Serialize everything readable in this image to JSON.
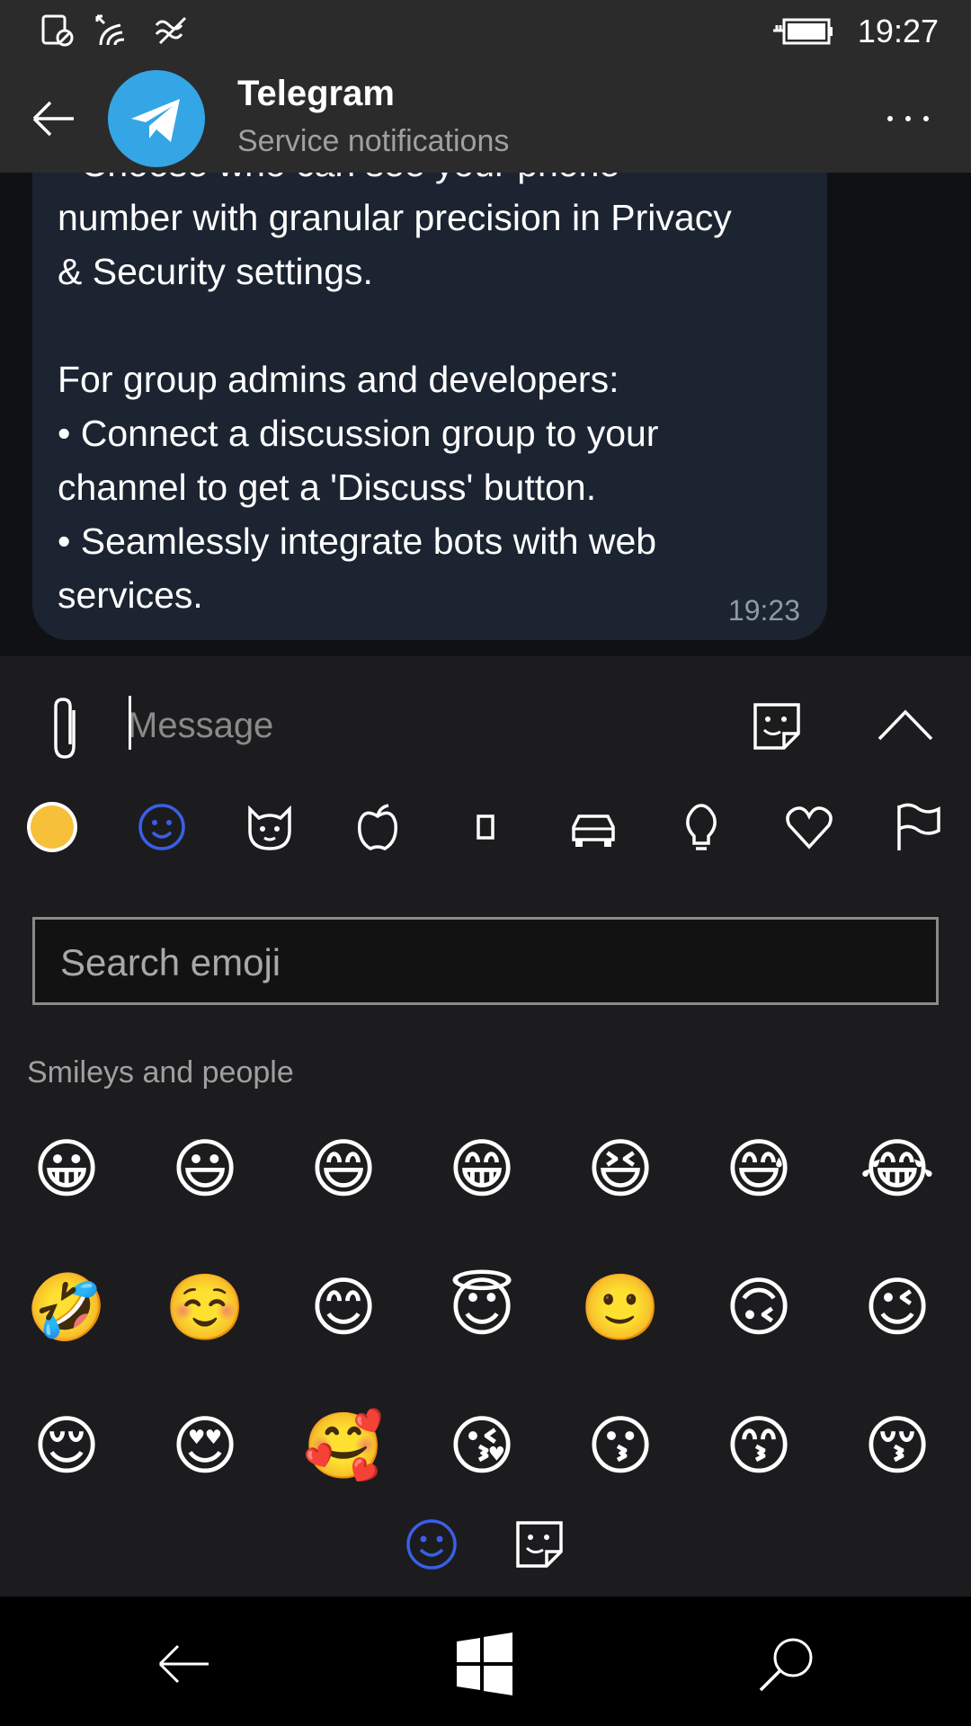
{
  "status_bar": {
    "time": "19:27",
    "icons": [
      "battery-saver-icon",
      "wifi-icon",
      "cellular-icon",
      "battery-charging-icon"
    ]
  },
  "header": {
    "title": "Telegram",
    "subtitle": "Service notifications",
    "more_label": "...",
    "accent": "#34a5e5"
  },
  "message": {
    "text": "• Choose who can see your phone\nnumber with granular precision in Privacy\n& Security settings.\n\nFor group admins and developers:\n• Connect a discussion group to your\nchannel to get a 'Discuss' button.\n• Seamlessly integrate bots with web\nservices.",
    "time": "19:23"
  },
  "composer": {
    "placeholder": "Message"
  },
  "emoji_panel": {
    "categories": [
      "recent",
      "smileys",
      "animals",
      "food",
      "activity",
      "travel",
      "objects",
      "symbols",
      "flags"
    ],
    "search_placeholder": "Search emoji",
    "section_title": "Smileys and people",
    "emojis": [
      [
        "😀",
        "😃",
        "😄",
        "😁",
        "😆",
        "😅",
        "😂"
      ],
      [
        "🤣",
        "☺️",
        "😊",
        "😇",
        "🙂",
        "🙃",
        "😉"
      ],
      [
        "😌",
        "😍",
        "🥰",
        "😘",
        "😗",
        "😙",
        "😚"
      ]
    ],
    "active_color": "#3a5fe6"
  }
}
